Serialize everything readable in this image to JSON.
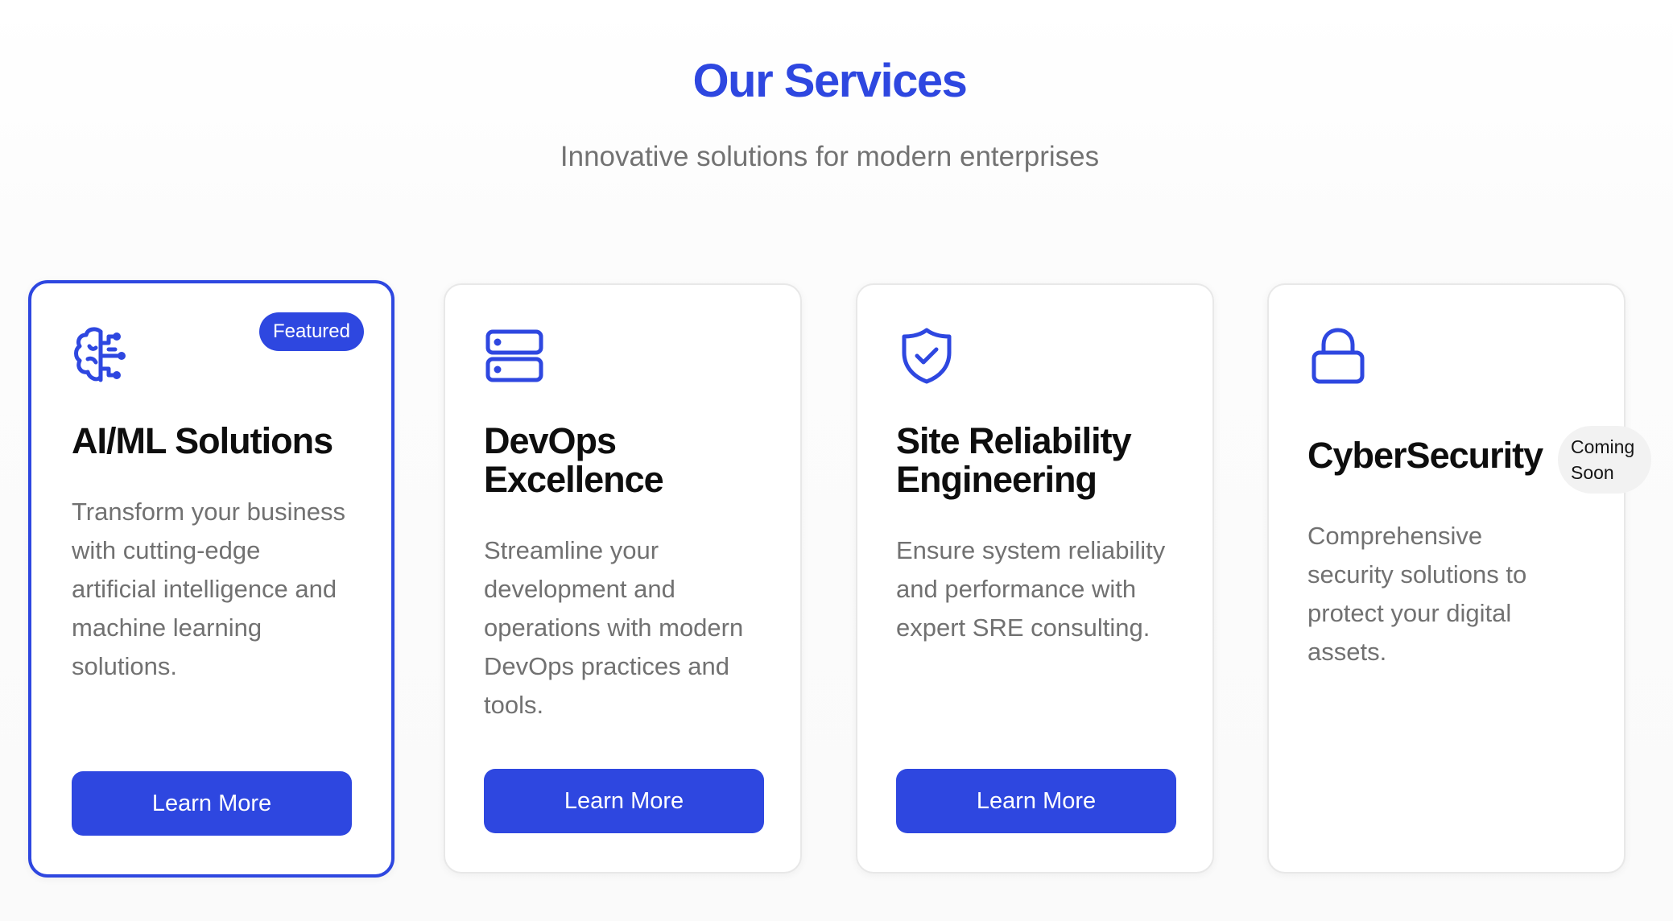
{
  "header": {
    "title": "Our Services",
    "subtitle": "Innovative solutions for modern enterprises"
  },
  "colors": {
    "accent": "#2e47e0",
    "title_text": "#0e0e0e",
    "body_text": "#717171",
    "card_border": "#e8e8e8",
    "badge_soon_bg": "#f2f2f2"
  },
  "cards": [
    {
      "icon": "brain-circuit-icon",
      "title": "AI/ML Solutions",
      "description": "Transform your business with cutting-edge artificial intelligence and machine learning solutions.",
      "badge": "Featured",
      "button": "Learn More"
    },
    {
      "icon": "server-icon",
      "title": "DevOps Excellence",
      "description": "Streamline your development and operations with modern DevOps practices and tools.",
      "button": "Learn More"
    },
    {
      "icon": "shield-check-icon",
      "title": "Site Reliability Engineering",
      "description": "Ensure system reliability and performance with expert SRE consulting.",
      "button": "Learn More"
    },
    {
      "icon": "lock-icon",
      "title": "CyberSecurity",
      "description": "Comprehensive security solutions to protect your digital assets.",
      "badge": "Coming Soon"
    }
  ]
}
